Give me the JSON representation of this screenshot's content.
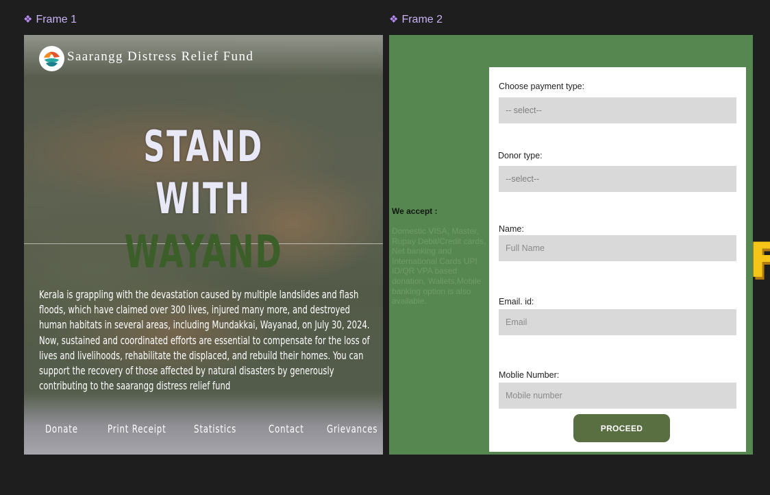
{
  "canvas": {
    "frame1_label": "Frame 1",
    "frame2_label": "Frame 2"
  },
  "frame1": {
    "org_name": "Saarangg Distress Relief Fund",
    "hero": [
      "STAND",
      "WITH",
      "WAYAND"
    ],
    "appeal": "Kerala is grappling with the devastation caused by multiple landslides and flash floods, which have claimed over 300 lives, injured many more, and destroyed human habitats in several areas, including Mundakkai, Wayanad, on July 30, 2024. Now, sustained and coordinated efforts are essential to compensate for the loss of lives and livelihoods, rehabilitate the displaced, and rebuild their homes. You can support the recovery of those affected by natural disasters by generously contributing to the saarangg distress relief fund",
    "nav": [
      "Donate",
      "Print Receipt",
      "Statistics",
      "Contact",
      "Grievances"
    ]
  },
  "frame2": {
    "accept_title": "We accept :",
    "accept_body": "Domestic VISA, Master, Rupay Debit/Credit cards, Net banking and International Cards UPI ID/QR VPA based donation, Wallets,Mobile banking option is also available.",
    "form": {
      "payment_type": {
        "label": "Choose payment type:",
        "value": "-- select--"
      },
      "donor_type": {
        "label": "Donor type:",
        "value": "--select--"
      },
      "name": {
        "label": "Name:",
        "placeholder": "Full Name"
      },
      "email": {
        "label": "Email. id:",
        "placeholder": "Email"
      },
      "mobile": {
        "label": "Moblie Number:",
        "placeholder": "Mobile number"
      },
      "proceed_label": "PROCEED"
    },
    "edge_glyph": "F"
  },
  "colors": {
    "canvas_bg": "#1e1e1e",
    "frame_label": "#c9b3f5",
    "frame2_bg": "#578751",
    "proceed_bg": "#596f42",
    "hero_accent": "#3c5f2a"
  }
}
